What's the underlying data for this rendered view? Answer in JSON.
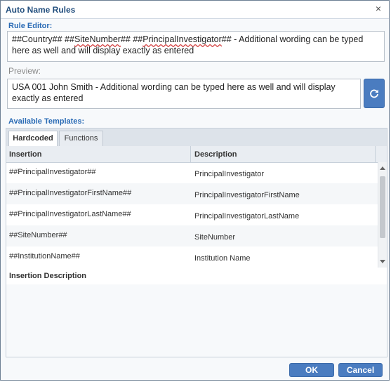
{
  "window": {
    "title": "Auto Name Rules",
    "close_glyph": "×"
  },
  "rule_editor": {
    "label": "Rule Editor:",
    "value_parts": [
      {
        "text": "##Country## ##",
        "flag": false
      },
      {
        "text": "SiteNumber",
        "flag": true
      },
      {
        "text": "## ##",
        "flag": false
      },
      {
        "text": "PrincipalInvestigator",
        "flag": true
      },
      {
        "text": "## - Additional wording can be typed here as well and will display exactly as entered",
        "flag": false
      }
    ]
  },
  "preview": {
    "label": "Preview:",
    "value": "USA 001 John Smith - Additional wording can be typed here as well and will display exactly as entered",
    "refresh_icon": "refresh-icon"
  },
  "templates": {
    "label": "Available Templates:",
    "tabs": [
      {
        "label": "Hardcoded",
        "active": true
      },
      {
        "label": "Functions",
        "active": false
      }
    ],
    "columns": {
      "insertion": "Insertion",
      "description": "Description"
    },
    "rows": [
      {
        "insertion": "##PrincipalInvestigator##",
        "description": "PrincipalInvestigator"
      },
      {
        "insertion": "##PrincipalInvestigatorFirstName##",
        "description": "PrincipalInvestigatorFirstName"
      },
      {
        "insertion": "##PrincipalInvestigatorLastName##",
        "description": "PrincipalInvestigatorLastName"
      },
      {
        "insertion": "##SiteNumber##",
        "description": "SiteNumber"
      },
      {
        "insertion": "##InstitutionName##",
        "description": "Institution Name"
      }
    ],
    "insertion_description_label": "Insertion Description"
  },
  "footer": {
    "ok_label": "OK",
    "cancel_label": "Cancel"
  },
  "colors": {
    "accent": "#2a6bb5",
    "button_blue": "#4a7cc0",
    "title_text": "#234f7e"
  }
}
